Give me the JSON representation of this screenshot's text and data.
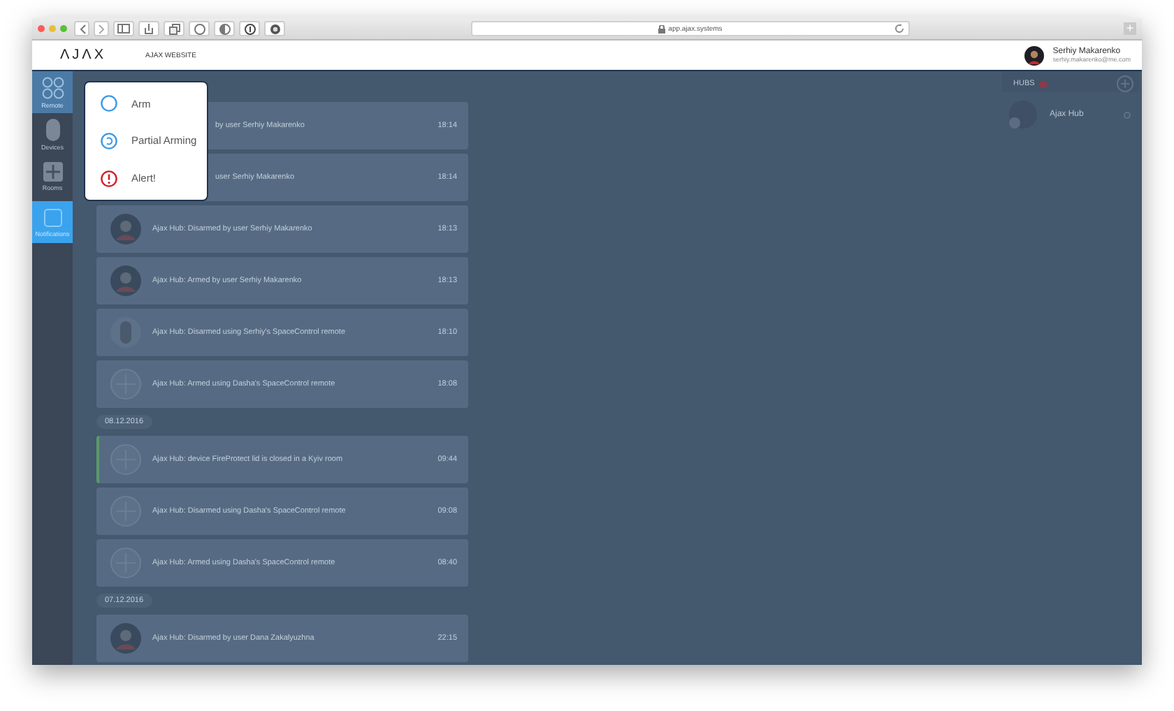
{
  "browser": {
    "url": "app.ajax.systems",
    "new_tab": "+"
  },
  "header": {
    "logo": "ΛJΛX",
    "link": "AJAX WEBSITE",
    "user": {
      "name": "Serhiy Makarenko",
      "email": "serhiy.makarenko@me.com"
    }
  },
  "sidebar": {
    "items": [
      {
        "label": "Remote",
        "kind": "remote",
        "open": true,
        "selected": false
      },
      {
        "label": "Devices",
        "kind": "device",
        "open": false,
        "selected": false
      },
      {
        "label": "Rooms",
        "kind": "room",
        "open": false,
        "selected": false
      },
      {
        "label": "Notifications",
        "kind": "bell",
        "open": false,
        "selected": true
      }
    ]
  },
  "menu": {
    "items": [
      {
        "label": "Arm",
        "kind": "arm"
      },
      {
        "label": "Partial Arming",
        "kind": "partial"
      },
      {
        "label": "Alert!",
        "kind": "alert"
      }
    ]
  },
  "events": [
    {
      "kind": "covered",
      "text": "by user Serhiy Makarenko",
      "time": "18:14"
    },
    {
      "kind": "covered",
      "text": "user Serhiy Makarenko",
      "time": "18:14"
    },
    {
      "kind": "person",
      "text": "Ajax Hub: Disarmed by user Serhiy Makarenko",
      "time": "18:13",
      "alarm": false
    },
    {
      "kind": "person",
      "text": "Ajax Hub: Armed by user Serhiy Makarenko",
      "time": "18:13",
      "alarm": false
    },
    {
      "kind": "remote",
      "text": "Ajax Hub: Disarmed using Serhiy's SpaceControl remote",
      "time": "18:10",
      "alarm": false
    },
    {
      "kind": "hub",
      "text": "Ajax Hub: Armed using Dasha's SpaceControl remote",
      "time": "18:08",
      "alarm": false
    },
    {
      "kind": "date",
      "text": "08.12.2016"
    },
    {
      "kind": "hub",
      "text": "Ajax Hub: device FireProtect lid is closed in a Kyiv room",
      "time": "09:44",
      "alarm": true
    },
    {
      "kind": "hub",
      "text": "Ajax Hub: Disarmed using Dasha's SpaceControl remote",
      "time": "09:08",
      "alarm": false
    },
    {
      "kind": "hub",
      "text": "Ajax Hub: Armed using Dasha's SpaceControl remote",
      "time": "08:40",
      "alarm": false
    },
    {
      "kind": "date",
      "text": "07.12.2016"
    },
    {
      "kind": "person",
      "text": "Ajax Hub: Disarmed by user Dana Zakalyuzhna",
      "time": "22:15",
      "alarm": false
    }
  ],
  "hubs": {
    "title": "HUBS",
    "items": [
      {
        "name": "Ajax Hub"
      }
    ]
  }
}
